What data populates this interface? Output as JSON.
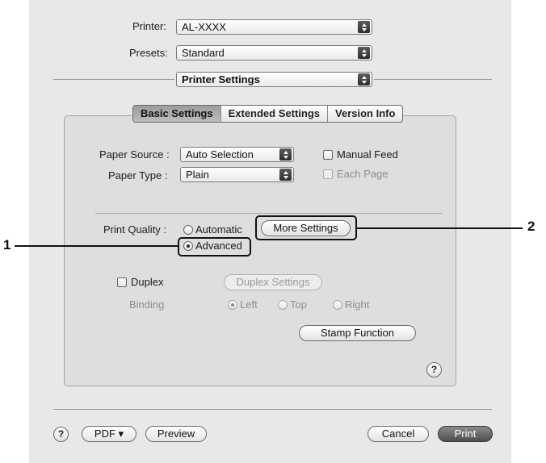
{
  "printer": {
    "label": "Printer:",
    "value": "AL-XXXX"
  },
  "presets": {
    "label": "Presets:",
    "value": "Standard"
  },
  "pane_selector": {
    "value": "Printer Settings"
  },
  "tabs": [
    {
      "label": "Basic Settings",
      "selected": true
    },
    {
      "label": "Extended Settings",
      "selected": false
    },
    {
      "label": "Version Info",
      "selected": false
    }
  ],
  "paper_source": {
    "label": "Paper Source :",
    "value": "Auto Selection"
  },
  "paper_type": {
    "label": "Paper Type :",
    "value": "Plain"
  },
  "manual_feed": {
    "label": "Manual Feed",
    "checked": false
  },
  "each_page": {
    "label": "Each Page",
    "checked": false,
    "enabled": false
  },
  "print_quality": {
    "label": "Print Quality :",
    "automatic_label": "Automatic",
    "advanced_label": "Advanced",
    "selected": "Advanced",
    "more_settings_label": "More Settings"
  },
  "duplex": {
    "label": "Duplex",
    "checked": false,
    "settings_label": "Duplex Settings",
    "binding_label": "Binding",
    "binding_options": [
      "Left",
      "Top",
      "Right"
    ],
    "binding_selected": "Left"
  },
  "stamp_function_label": "Stamp Function",
  "help_glyph": "?",
  "bottom_bar": {
    "pdf_label": "PDF ▾",
    "preview_label": "Preview",
    "cancel_label": "Cancel",
    "print_label": "Print"
  },
  "callouts": {
    "one": "1",
    "two": "2"
  }
}
